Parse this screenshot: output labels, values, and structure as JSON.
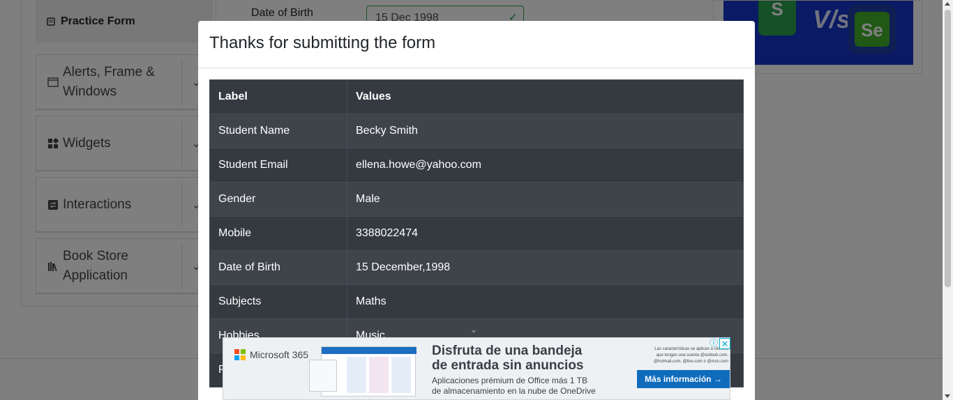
{
  "sidebar": {
    "current": "Practice Form",
    "groups": [
      {
        "label": "Alerts, Frame & Windows"
      },
      {
        "label": "Widgets"
      },
      {
        "label": "Interactions"
      },
      {
        "label": "Book Store Application"
      }
    ]
  },
  "form": {
    "dob_label": "Date of Birth",
    "dob_value": "15 Dec 1998"
  },
  "ad_right": {
    "vs": "V/s",
    "logo_s": "S",
    "logo_se": "Se"
  },
  "modal": {
    "title": "Thanks for submitting the form",
    "headers": [
      "Label",
      "Values"
    ],
    "rows": [
      {
        "label": "Student Name",
        "value": "Becky Smith"
      },
      {
        "label": "Student Email",
        "value": "ellena.howe@yahoo.com"
      },
      {
        "label": "Gender",
        "value": "Male"
      },
      {
        "label": "Mobile",
        "value": "3388022474"
      },
      {
        "label": "Date of Birth",
        "value": "15 December,1998"
      },
      {
        "label": "Subjects",
        "value": "Maths"
      },
      {
        "label": "Hobbies",
        "value": "Music"
      },
      {
        "label": "P",
        "value": ""
      }
    ]
  },
  "bottom_ad": {
    "brand": "Microsoft 365",
    "headline_1": "Disfruta de una bandeja",
    "headline_2": "de entrada sin anuncios",
    "sub_1": "Aplicaciones prémium de Office más 1 TB",
    "sub_2": "de almacenamiento en la nube de OneDrive",
    "fine_print": "Las características se aplican a clientes que tengan una cuenta @outlook.com, @hotmail.com, @live.com o @msn.com",
    "cta": "Más información →",
    "info": "ⓘ",
    "close": "✕"
  },
  "colors": {
    "table_dark": "#343a40",
    "table_stripe": "#3e444a",
    "accent_green": "#28a745",
    "cta_blue": "#0f6cbd"
  }
}
